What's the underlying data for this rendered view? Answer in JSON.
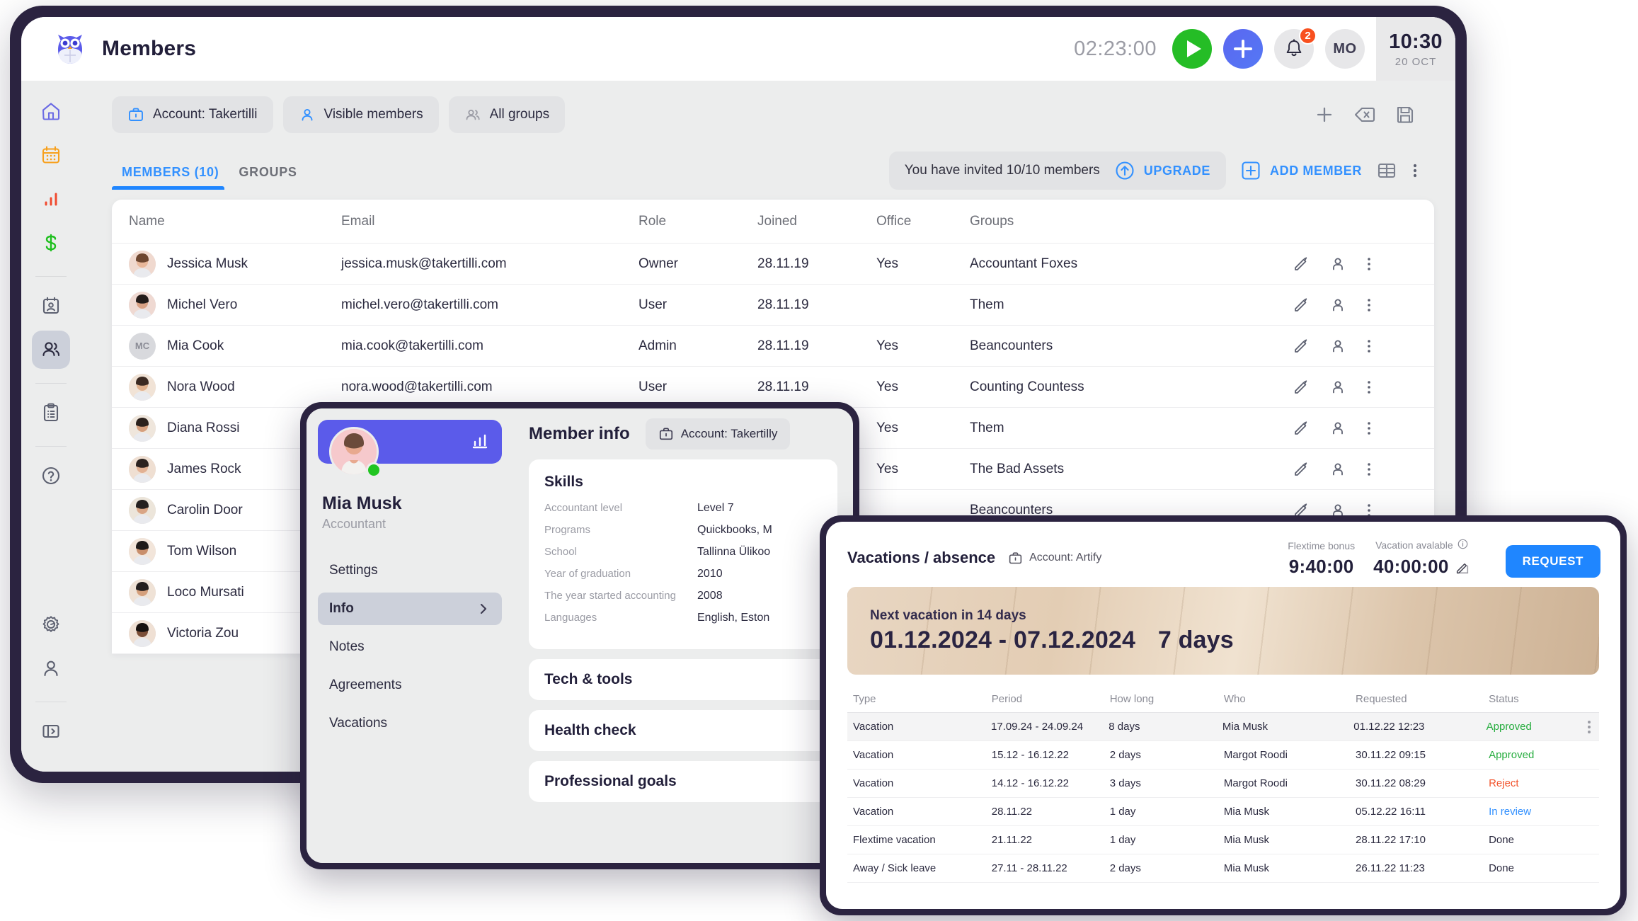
{
  "header": {
    "app_title": "Members",
    "logo_icon": "owl-logo-icon",
    "timer": "02:23:00",
    "play_icon": "play-icon",
    "add_icon": "plus-icon",
    "bell_icon": "bell-icon",
    "notification_count": "2",
    "user_initials": "MO",
    "clock_time": "10:30",
    "clock_date": "20 OCT"
  },
  "sidebar": {
    "items": [
      {
        "icon": "home-icon",
        "active": false
      },
      {
        "icon": "calendar-icon",
        "active": false
      },
      {
        "icon": "bar-chart-icon",
        "active": false
      },
      {
        "icon": "dollar-icon",
        "active": false
      },
      {
        "icon": "contact-card-icon",
        "active": false
      },
      {
        "icon": "people-icon",
        "active": true
      },
      {
        "icon": "clipboard-list-icon",
        "active": false
      },
      {
        "icon": "help-circle-icon",
        "active": false
      }
    ],
    "bottom_items": [
      {
        "icon": "gear-icon"
      },
      {
        "icon": "person-icon"
      },
      {
        "icon": "panel-toggle-icon"
      }
    ]
  },
  "filters": [
    {
      "label": "Account: Takertilli",
      "icon": "briefcase-icon"
    },
    {
      "label": "Visible members",
      "icon": "person-icon"
    },
    {
      "label": "All groups",
      "icon": "group-icon"
    }
  ],
  "toolbar_icons": [
    {
      "name": "plus-icon"
    },
    {
      "name": "delete-backspace-icon"
    },
    {
      "name": "save-floppy-icon"
    }
  ],
  "tabs": [
    {
      "label": "MEMBERS (10)",
      "active": true
    },
    {
      "label": "GROUPS",
      "active": false
    }
  ],
  "invite": {
    "text": "You have invited 10/10 members",
    "upgrade_label": "UPGRADE",
    "upgrade_icon": "arrow-up-circle-icon",
    "add_member_label": "ADD MEMBER",
    "add_member_icon": "plus-square-icon",
    "table_view_icon": "table-grid-icon",
    "more_icon": "more-vertical-icon"
  },
  "members_table": {
    "columns": [
      "Name",
      "Email",
      "Role",
      "Joined",
      "Office",
      "Groups"
    ],
    "rows": [
      {
        "name": "Jessica Musk",
        "email": "jessica.musk@takertilli.com",
        "role": "Owner",
        "joined": "28.11.19",
        "office": "Yes",
        "groups": "Accountant Foxes",
        "avatar_initials": ""
      },
      {
        "name": "Michel Vero",
        "email": "michel.vero@takertilli.com",
        "role": "User",
        "joined": "28.11.19",
        "office": "",
        "groups": "Them",
        "avatar_initials": ""
      },
      {
        "name": "Mia Cook",
        "email": "mia.cook@takertilli.com",
        "role": "Admin",
        "joined": "28.11.19",
        "office": "Yes",
        "groups": "Beancounters",
        "avatar_initials": "MC"
      },
      {
        "name": "Nora Wood",
        "email": "nora.wood@takertilli.com",
        "role": "User",
        "joined": "28.11.19",
        "office": "Yes",
        "groups": "Counting Countess",
        "avatar_initials": ""
      },
      {
        "name": "Diana Rossi",
        "email": "",
        "role": "",
        "joined": "",
        "office": "Yes",
        "groups": "Them",
        "avatar_initials": ""
      },
      {
        "name": "James Rock",
        "email": "",
        "role": "",
        "joined": "",
        "office": "Yes",
        "groups": "The Bad Assets",
        "avatar_initials": ""
      },
      {
        "name": "Carolin Door",
        "email": "",
        "role": "",
        "joined": "",
        "office": "",
        "groups": "Beancounters",
        "avatar_initials": ""
      },
      {
        "name": "Tom Wilson",
        "email": "",
        "role": "",
        "joined": "",
        "office": "",
        "groups": "",
        "avatar_initials": ""
      },
      {
        "name": "Loco Mursati",
        "email": "",
        "role": "",
        "joined": "",
        "office": "",
        "groups": "",
        "avatar_initials": ""
      },
      {
        "name": "Victoria Zou",
        "email": "",
        "role": "",
        "joined": "",
        "office": "",
        "groups": "",
        "avatar_initials": ""
      }
    ],
    "row_actions": {
      "edit_icon": "pencil-icon",
      "user_icon": "person-icon",
      "more_icon": "more-vertical-icon"
    }
  },
  "member_panel": {
    "name": "Mia Musk",
    "role": "Accountant",
    "chart_icon": "bar-chart-icon",
    "status_dot": "online-status-icon",
    "menu": [
      {
        "label": "Settings",
        "active": false
      },
      {
        "label": "Info",
        "active": true
      },
      {
        "label": "Notes",
        "active": false
      },
      {
        "label": "Agreements",
        "active": false
      },
      {
        "label": "Vacations",
        "active": false
      }
    ],
    "title": "Member info",
    "account_chip": "Account: Takertilly",
    "account_icon": "briefcase-icon",
    "skills_title": "Skills",
    "skills": [
      {
        "key": "Accountant level",
        "value": "Level 7"
      },
      {
        "key": "Programs",
        "value": "Quickbooks, M"
      },
      {
        "key": "School",
        "value": "Tallinna Ülikoo"
      },
      {
        "key": "Year of graduation",
        "value": "2010"
      },
      {
        "key": "The year started accounting",
        "value": "2008"
      },
      {
        "key": "Languages",
        "value": "English, Eston"
      }
    ],
    "sections": [
      "Tech & tools",
      "Health check",
      "Professional goals"
    ]
  },
  "vacations_panel": {
    "title": "Vacations / absence",
    "account_chip": "Account: Artify",
    "account_icon": "briefcase-icon",
    "flextime_label": "Flextime bonus",
    "flextime_value": "9:40:00",
    "available_label": "Vacation avalable",
    "available_info_icon": "info-circle-icon",
    "available_value": "40:00:00",
    "edit_icon": "pencil-square-icon",
    "request_label": "REQUEST",
    "banner": {
      "subtitle": "Next vacation in 14 days",
      "range": "01.12.2024 - 07.12.2024",
      "days": "7 days"
    },
    "columns": [
      "Type",
      "Period",
      "How long",
      "Who",
      "Requested",
      "Status"
    ],
    "rows": [
      {
        "type": "Vacation",
        "period": "17.09.24 - 24.09.24",
        "how_long": "8 days",
        "who": "Mia Musk",
        "requested": "01.12.22 12:23",
        "status": "Approved",
        "status_kind": "approved",
        "has_more": true
      },
      {
        "type": "Vacation",
        "period": "15.12 - 16.12.22",
        "how_long": "2 days",
        "who": "Margot Roodi",
        "requested": "30.11.22 09:15",
        "status": "Approved",
        "status_kind": "approved",
        "has_more": false
      },
      {
        "type": "Vacation",
        "period": "14.12 - 16.12.22",
        "how_long": "3 days",
        "who": "Margot Roodi",
        "requested": "30.11.22 08:29",
        "status": "Reject",
        "status_kind": "reject",
        "has_more": false
      },
      {
        "type": "Vacation",
        "period": "28.11.22",
        "how_long": "1 day",
        "who": "Mia Musk",
        "requested": "05.12.22 16:11",
        "status": "In review",
        "status_kind": "review",
        "has_more": false
      },
      {
        "type": "Flextime vacation",
        "period": "21.11.22",
        "how_long": "1 day",
        "who": "Mia Musk",
        "requested": "28.11.22 17:10",
        "status": "Done",
        "status_kind": "done",
        "has_more": false
      },
      {
        "type": "Away / Sick leave",
        "period": "27.11 - 28.11.22",
        "how_long": "2 days",
        "who": "Mia Musk",
        "requested": "26.11.22 11:23",
        "status": "Done",
        "status_kind": "done",
        "has_more": false
      }
    ]
  },
  "colors": {
    "accent_blue": "#1f86ff",
    "purple": "#5b5bea",
    "green": "#25bd26",
    "red_badge": "#f8501f",
    "frame_dark": "#2b2340",
    "approved": "#27ad3f",
    "reject": "#f2542d",
    "review": "#3391ff"
  }
}
